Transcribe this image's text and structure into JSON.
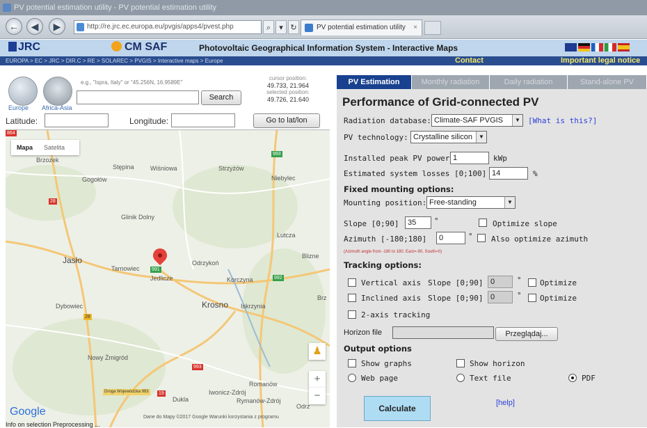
{
  "browser": {
    "window_title": "PV potential estimation utility - PV potential estimation utility",
    "back_icon": "back-arrow-icon",
    "address": "http://re.jrc.ec.europa.eu/pvgis/apps4/pvest.php",
    "tab_title": "PV potential estimation utility",
    "tab_close": "×"
  },
  "header": {
    "jrc_logo": "JRC",
    "cmsaf_logo": "CM SAF",
    "title": "Photovoltaic Geographical Information System - Interactive Maps",
    "flags": [
      "#1f3a8f",
      "#111111",
      "#1f5fbf",
      "#d42a2a",
      "#2e9a3c",
      "#e0b21a"
    ],
    "breadcrumb": "EUROPA > EC > JRC > DIR.C > RE > SOLAREC > PVGIS > Interactive maps > Europe",
    "contact": "Contact",
    "legal": "Important legal notice"
  },
  "search": {
    "globe1_label": "Europe",
    "globe2_label": "Africa-Asia",
    "hint": "e.g., \"Ispra, Italy\" or \"45.256N, 16.9589E\"",
    "search_button": "Search",
    "cursor_label": "cursor position:",
    "cursor_value": "49.733, 21.964",
    "selected_label": "selected position:",
    "selected_value": "49.726, 21.640",
    "latitude_label": "Latitude:",
    "longitude_label": "Longitude:",
    "goto_button": "Go to lat/lon"
  },
  "map": {
    "type_map": "Mapa",
    "type_satellite": "Satelita",
    "places": {
      "brzozow": "Brzozek",
      "stepina": "Stępina",
      "wisniowa": "Wiśniowa",
      "strzyzow": "Strzyżów",
      "niebylec": "Niebylec",
      "gogolow": "Gogołów",
      "glinik": "Glinik Dolny",
      "lutcza": "Lutcza",
      "jaslo": "Jasło",
      "tarnowiec": "Tarnowiec",
      "jedlicze": "Jedlicze",
      "odrzykon": "Odrzykoń",
      "korczyna": "Korczyna",
      "blizne": "Blizne",
      "dybowiec": "Dybowiec",
      "krosno": "Krosno",
      "iskrzynia": "Iskrzynia",
      "nowy_zmigrod": "Nowy Żmigród",
      "romanow": "Romanów",
      "iwonicz": "Iwonicz-Zdrój",
      "rymanow": "Rymanów-Zdrój",
      "dukla": "Dukla",
      "odrz": "Odrz",
      "droga": "Droga Wojewódzka 993",
      "brz": "Brz"
    },
    "badges": [
      "864",
      "993",
      "28",
      "992",
      "991",
      "28",
      "993",
      "19"
    ],
    "pegman_icon": "pegman-icon",
    "zoom_in": "+",
    "zoom_out": "−",
    "google_logo": "Google",
    "footer": "Dane do Mapy ©2017 Google   Warunki korzystania z programu",
    "lower_tabs": "Info on selection    Preprocessing    ..."
  },
  "panel": {
    "tabs": [
      "PV Estimation",
      "Monthly radiation",
      "Daily radiation",
      "Stand-alone PV"
    ],
    "title": "Performance of Grid-connected PV",
    "radiation_db_label": "Radiation database:",
    "radiation_db_value": "Climate-SAF PVGIS",
    "what_is_this": "[What is this?]",
    "pv_tech_label": "PV technology:",
    "pv_tech_value": "Crystalline silicon",
    "peak_power_label": "Installed peak PV power",
    "peak_power_value": "1",
    "peak_power_unit": "kWp",
    "losses_label": "Estimated system losses [0;100]",
    "losses_value": "14",
    "losses_unit": "%",
    "fixed_heading": "Fixed mounting options:",
    "mounting_label": "Mounting position:",
    "mounting_value": "Free-standing",
    "slope_label": "Slope [0;90]",
    "slope_value": "35",
    "deg": "°",
    "optimize_slope": "Optimize slope",
    "azimuth_label": "Azimuth [-180;180]",
    "azimuth_value": "0",
    "also_optimize": "Also optimize azimuth",
    "azimuth_note": "(Azimuth angle from -180 to 180. East=-90, South=0)",
    "tracking_heading": "Tracking options:",
    "vertical_axis": "Vertical axis",
    "inclined_axis": "Inclined axis",
    "two_axis": "2-axis tracking",
    "track_slope_label": "Slope [0;90]",
    "track_slope_value": "0",
    "optimize": "Optimize",
    "horizon_label": "Horizon file",
    "browse_button": "Przeglądaj...",
    "output_heading": "Output options",
    "show_graphs": "Show graphs",
    "show_horizon": "Show horizon",
    "web_page": "Web page",
    "text_file": "Text file",
    "pdf": "PDF",
    "calculate": "Calculate",
    "help": "[help]"
  }
}
